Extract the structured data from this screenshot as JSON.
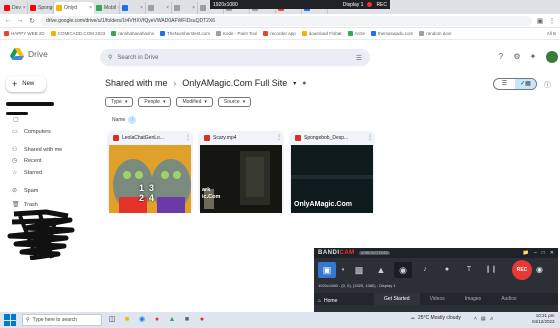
{
  "browser": {
    "tabs": [
      {
        "label": "Dev",
        "color": "#ff0000"
      },
      {
        "label": "Spongeb",
        "color": "#ff0000"
      },
      {
        "label": "Onlyd",
        "color": "#f4b400",
        "active": true
      },
      {
        "label": "Mobil",
        "color": "#34a853"
      },
      {
        "label": "",
        "color": "#1a73e8"
      },
      {
        "label": "",
        "color": "#9e9e9e"
      },
      {
        "label": "",
        "color": "#9e9e9e"
      },
      {
        "label": "",
        "color": "#9e9e9e"
      },
      {
        "label": "Mt",
        "color": "#9e9e9e"
      },
      {
        "label": "Rab",
        "color": "#9e9e9e"
      },
      {
        "label": "To Ow",
        "color": "#ea4335"
      },
      {
        "label": "Mastr",
        "color": "#1a73e8"
      }
    ],
    "url": "drive.google.com/drive/u/1/folders/1t4VHXVfQyeVWAD0AFWFIDsuQDT2X6",
    "bookmarks": [
      "HAPPY WEB 2D",
      "COMICADD.COM 2023",
      "ranshahanahashs",
      "TheNumberstest.com",
      "Kode - Paint Tool",
      "recorder app",
      "download Fisbat",
      "Arcte",
      "themaswadu.com",
      "random door"
    ],
    "all_bookmarks_label": "All B"
  },
  "recording_overlay": {
    "resolution": "1920x1080",
    "display": "Display 1",
    "rec_label": "REC"
  },
  "drive": {
    "logo_text": "Drive",
    "search_placeholder": "Search in Drive",
    "new_label": "New",
    "sidebar": [
      {
        "label": "Computers",
        "icon": "computer-icon"
      },
      {
        "label": "Shared with me",
        "icon": "people-icon"
      },
      {
        "label": "Recent",
        "icon": "clock-icon"
      },
      {
        "label": "Starred",
        "icon": "star-icon"
      },
      {
        "label": "Spam",
        "icon": "spam-icon"
      },
      {
        "label": "Trash",
        "icon": "trash-icon"
      }
    ],
    "breadcrumb": {
      "parent": "Shared with me",
      "current": "OnlyAMagic.Com Full Site"
    },
    "filters": [
      "Type",
      "People",
      "Modified",
      "Source"
    ],
    "sort_label": "Name",
    "files": [
      {
        "name": "LeolaChatGenLo...",
        "type": "video-icon"
      },
      {
        "name": "Scary.mp4",
        "type": "video-icon"
      },
      {
        "name": "Spongebob_Desp...",
        "type": "video-icon"
      }
    ],
    "thumb_texts": {
      "file1_numbers": "1  3\n2  4",
      "file2_overlay": "ark\nic.Com",
      "file3_watermark": "OnlyAMagic.Com"
    }
  },
  "bandicam": {
    "brand_a": "BANDI",
    "brand_b": "CAM",
    "unregistered": "UNREGISTERED",
    "rec_label": "REC",
    "info": "1920x1080 - (0, 0), (1920, 1080) - Display 1",
    "tabs": [
      "Get Started",
      "Videos",
      "Images",
      "Audios"
    ],
    "home_label": "Home"
  },
  "taskbar": {
    "search_placeholder": "Type here to search",
    "weather": "25°C  Mostly cloudy",
    "time": "10:21 pm",
    "date": "04/12/2023"
  }
}
